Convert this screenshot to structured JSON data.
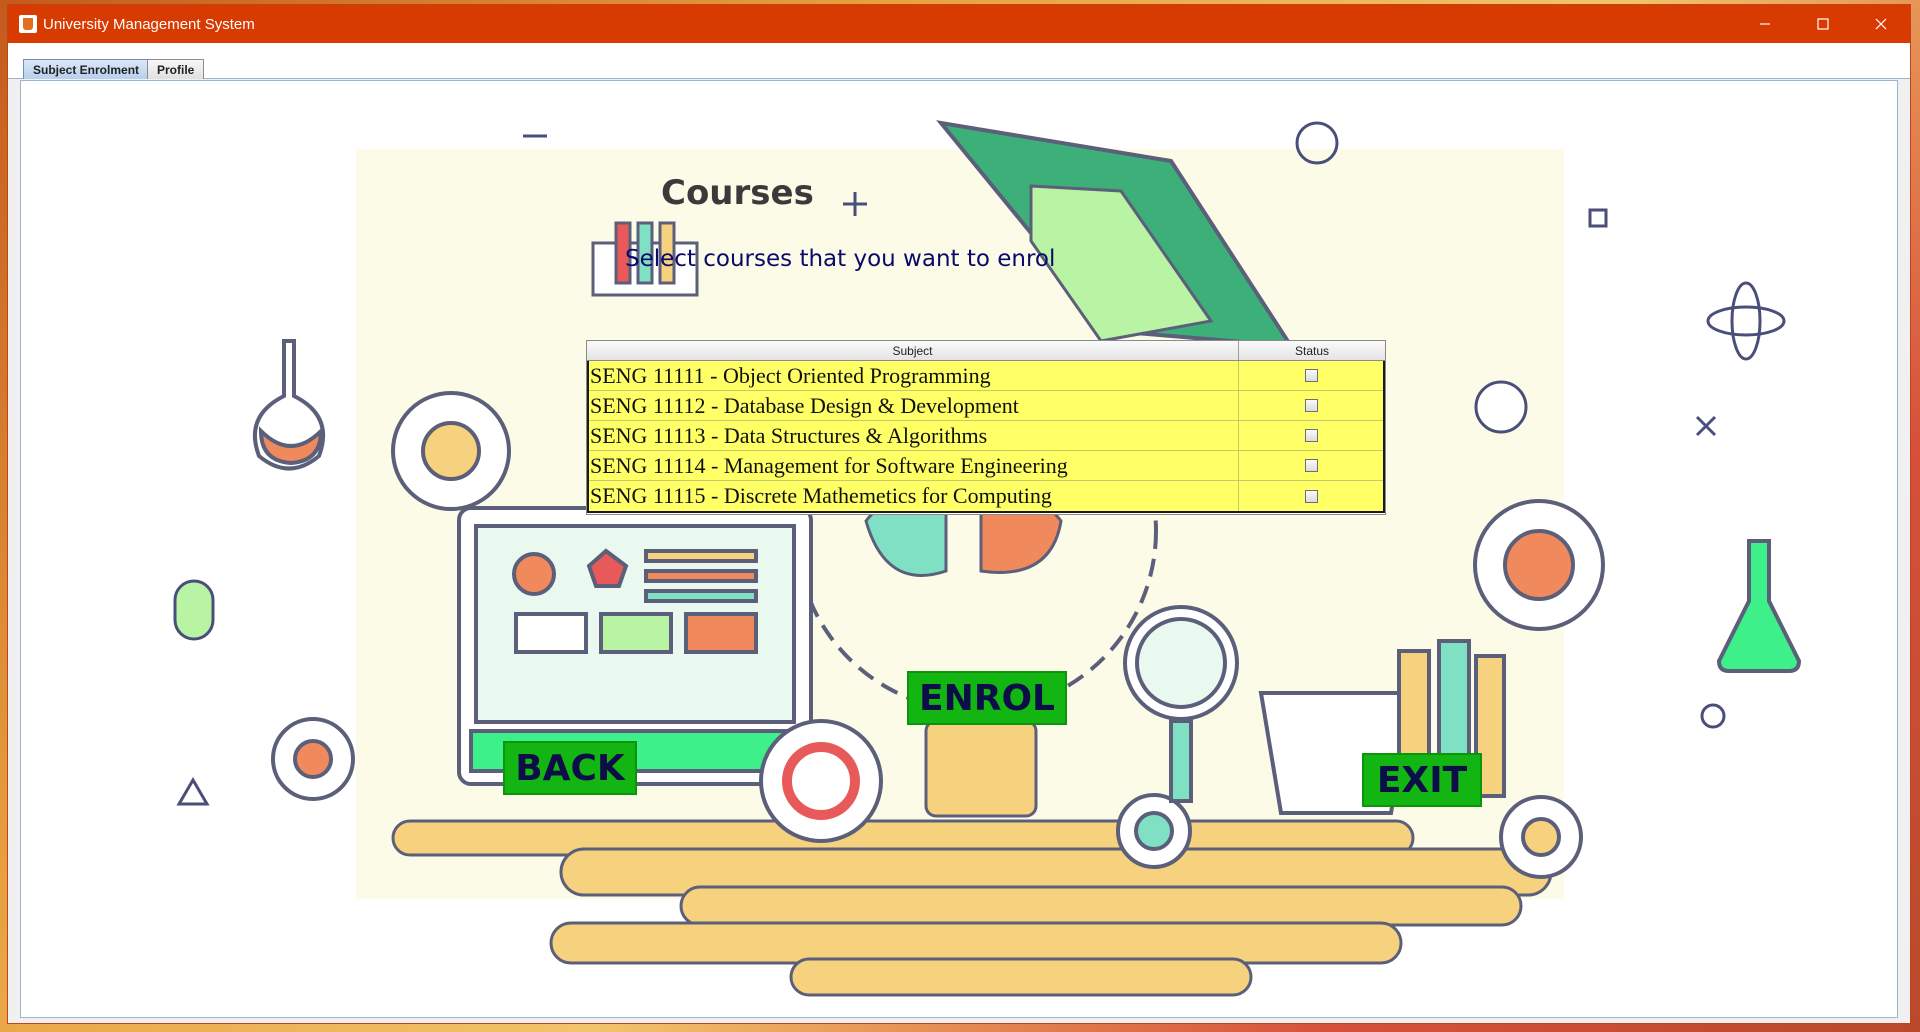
{
  "window": {
    "title": "University Management System",
    "minimize_icon": "minimize-icon",
    "maximize_icon": "maximize-icon",
    "close_icon": "close-icon"
  },
  "tabs": [
    {
      "label": "Subject Enrolment",
      "active": true
    },
    {
      "label": "Profile",
      "active": false
    }
  ],
  "main": {
    "heading": "Courses",
    "subheading": "Select courses that you want to enrol"
  },
  "table": {
    "columns": [
      "Subject",
      "Status"
    ],
    "rows": [
      {
        "subject": "SENG 11111 - Object Oriented Programming",
        "checked": false
      },
      {
        "subject": "SENG 11112 - Database Design & Development",
        "checked": false
      },
      {
        "subject": "SENG 11113 - Data Structures & Algorithms",
        "checked": false
      },
      {
        "subject": "SENG 11114 - Management for Software Engineering",
        "checked": false
      },
      {
        "subject": "SENG 11115 - Discrete Mathemetics for Computing",
        "checked": false
      }
    ]
  },
  "buttons": {
    "back": "BACK",
    "enrol": "ENROL",
    "exit": "EXIT"
  },
  "colors": {
    "titlebar": "#d83b01",
    "row_highlight": "#ffff66",
    "button_bg": "#12b512",
    "button_text": "#0d0d4a"
  }
}
